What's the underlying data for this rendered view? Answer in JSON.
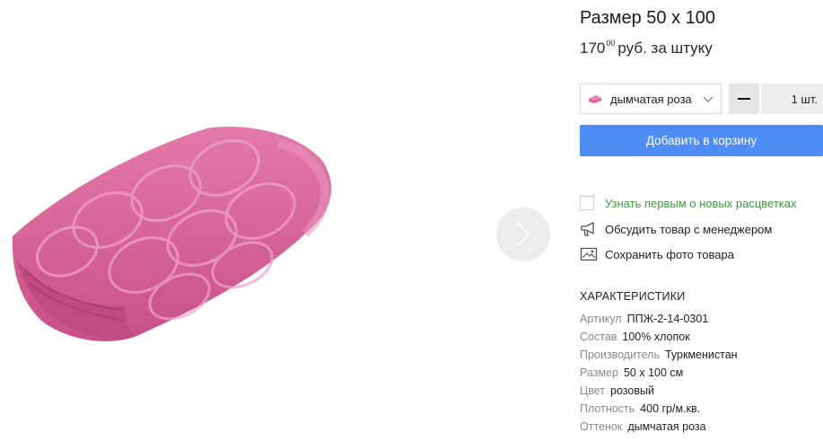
{
  "product": {
    "title": "Размер 50 х 100",
    "price_main": "170",
    "price_cents": "00",
    "price_unit": "руб. за штуку"
  },
  "selector": {
    "color_label": "дымчатая роза",
    "swatch_color": "#d9619a",
    "quantity": "1 шт."
  },
  "buttons": {
    "add_to_cart": "Добавить в корзину",
    "button_color": "#4e8df5"
  },
  "actions": {
    "notify_new_colors": "Узнать первым о новых расцветках",
    "discuss_with_manager": "Обсудить товар с менеджером",
    "save_photo": "Сохранить фото товара"
  },
  "characteristics": {
    "heading": "ХАРАКТЕРИСТИКИ",
    "rows": [
      {
        "label": "Артикул",
        "value": "ППЖ-2-14-0301"
      },
      {
        "label": "Состав",
        "value": "100% хлопок"
      },
      {
        "label": "Производитель",
        "value": "Туркменистан"
      },
      {
        "label": "Размер",
        "value": "50 х 100 см"
      },
      {
        "label": "Цвет",
        "value": "розовый"
      },
      {
        "label": "Плотность",
        "value": "400 гр/м.кв."
      },
      {
        "label": "Оттенок",
        "value": "дымчатая роза"
      }
    ]
  },
  "icons": {
    "next": "chevron-right-icon",
    "discuss": "megaphone-icon",
    "save": "photo-icon",
    "dropdown": "chevron-down-icon"
  },
  "colors": {
    "towel": "#d9619a",
    "link_green": "#3e9a3e"
  }
}
